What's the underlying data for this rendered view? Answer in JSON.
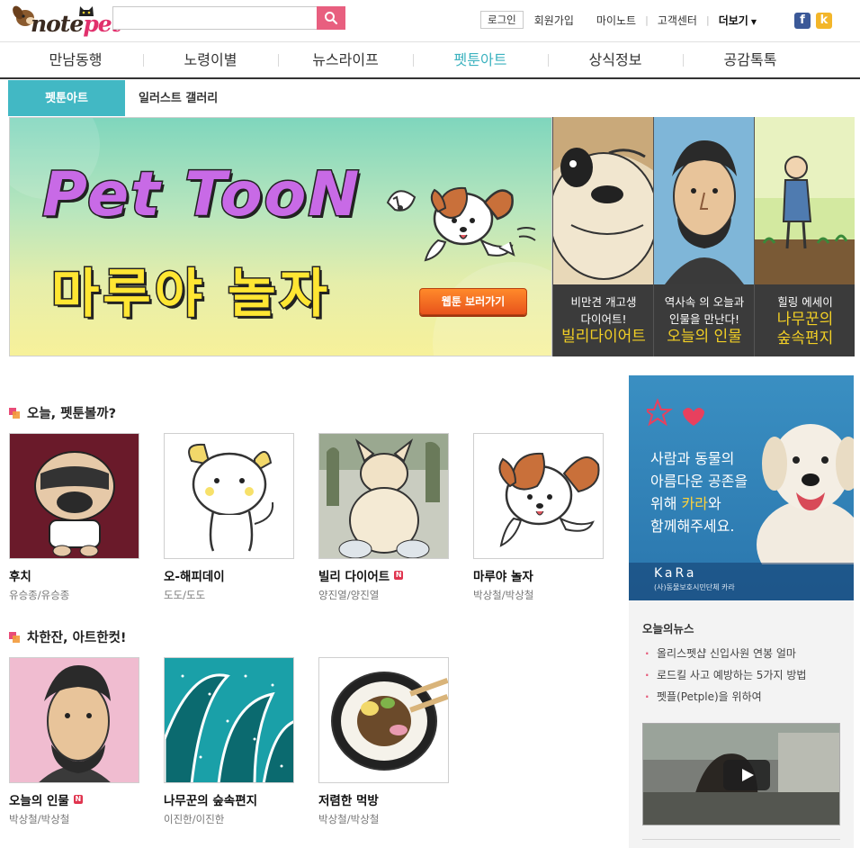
{
  "header": {
    "logo": {
      "text_main": "note",
      "text_accent": "pet"
    },
    "search": {
      "value": "",
      "placeholder": ""
    },
    "util": {
      "login": "로그인",
      "signup": "회원가입",
      "mynote": "마이노트",
      "customer": "고객센터",
      "more": "더보기"
    },
    "sns": {
      "facebook": "f",
      "kakaostory": "k"
    }
  },
  "gnb": {
    "items": [
      "만남동행",
      "노령이별",
      "뉴스라이프",
      "펫툰아트",
      "상식정보",
      "공감톡톡"
    ],
    "active_index": 3
  },
  "subnav": {
    "active": "펫툰아트",
    "item": "일러스트 갤러리"
  },
  "hero": {
    "title": "Pet TooN",
    "subtitle": "마루야 놀자",
    "button": "웹툰 보러가기",
    "side_cards": [
      {
        "line1": "비만견 개고생",
        "line2": "다이어트!",
        "title": "빌리다이어트"
      },
      {
        "line1": "역사속 의 오늘과",
        "line2": "인물을 만난다!",
        "title": "오늘의 인물"
      },
      {
        "line1": "힐링 에세이",
        "line2": "나무꾼의",
        "title": "숲속편지"
      }
    ]
  },
  "section1": {
    "title": "오늘, 펫툰볼까?",
    "items": [
      {
        "name": "후치",
        "author": "유승종/유승종",
        "new": false
      },
      {
        "name": "오-해피데이",
        "author": "도도/도도",
        "new": false
      },
      {
        "name": "빌리 다이어트",
        "author": "양진열/양진열",
        "new": true
      },
      {
        "name": "마루야 놀자",
        "author": "박상철/박상철",
        "new": false
      }
    ]
  },
  "section2": {
    "title": "차한잔, 아트한컷!",
    "items": [
      {
        "name": "오늘의 인물",
        "author": "박상철/박상철",
        "new": true
      },
      {
        "name": "나무꾼의 숲속편지",
        "author": "이진한/이진한",
        "new": false
      },
      {
        "name": "저렴한 먹방",
        "author": "박상철/박상철",
        "new": false
      }
    ]
  },
  "new_badge": "N",
  "right": {
    "ad": {
      "line1": "사람과 동물의",
      "line2": "아름다운 공존을",
      "line3_pre": "위해 ",
      "line3_hl": "카라",
      "line3_post": "와",
      "line4": "함께해주세요.",
      "org": "KaRa",
      "org_sub": "(사)동물보호시민단체 카라"
    },
    "news_title": "오늘의뉴스",
    "news": [
      "올리스펫샵 신입사원 연봉 얼마",
      "로드킬 사고 예방하는 5가지 방법",
      "펫플(Petple)을 위하여"
    ]
  },
  "colors": {
    "accent": "#42b8c4",
    "brand_pink": "#e85f7f",
    "badge": "#e0354f"
  }
}
